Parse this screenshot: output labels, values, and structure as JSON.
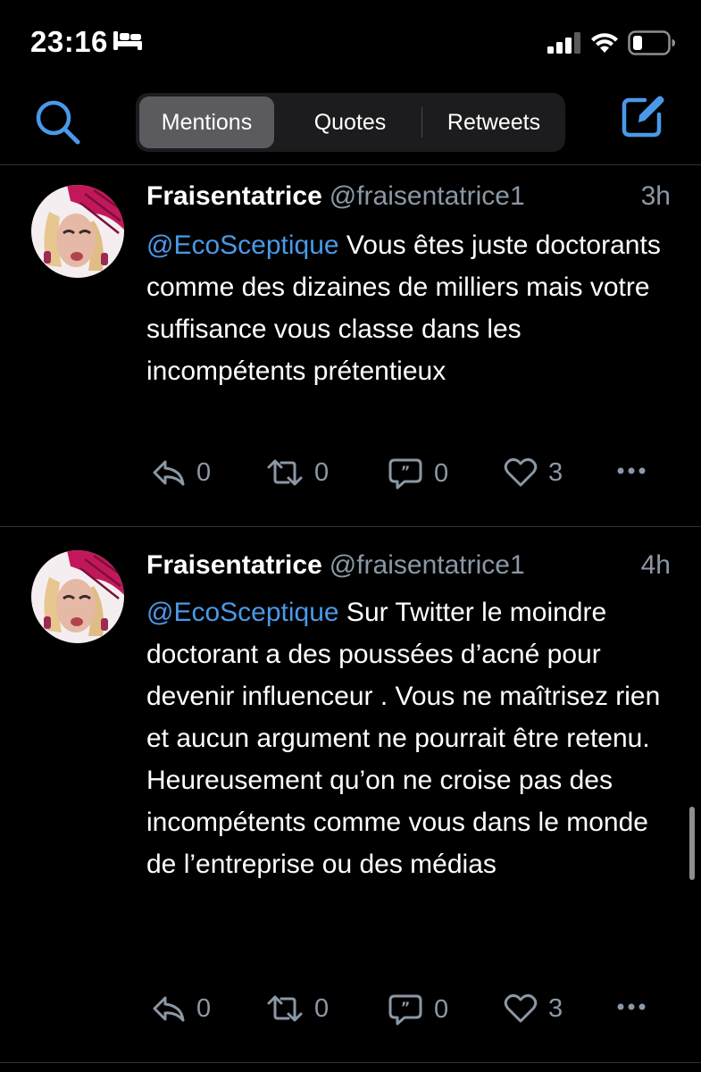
{
  "status_bar": {
    "time": "23:16",
    "icons": [
      "bed-icon",
      "signal-icon",
      "wifi-icon",
      "battery-icon"
    ]
  },
  "nav": {
    "tabs": [
      {
        "label": "Mentions",
        "active": true
      },
      {
        "label": "Quotes",
        "active": false
      },
      {
        "label": "Retweets",
        "active": false
      }
    ],
    "icons": [
      "search-icon",
      "compose-icon"
    ],
    "accent_color": "#4a99e9"
  },
  "tweets": [
    {
      "display_name": "Fraisentatrice",
      "handle": "@fraisentatrice1",
      "time": "3h",
      "mention": "@EcoSceptique",
      "body": " Vous êtes juste doctorants comme des dizaines de milliers mais votre suffisance vous classe dans les incompétents prétentieux",
      "replies": "0",
      "retweets": "0",
      "quotes": "0",
      "likes": "3"
    },
    {
      "display_name": "Fraisentatrice",
      "handle": "@fraisentatrice1",
      "time": "4h",
      "mention": "@EcoSceptique",
      "body": " Sur Twitter le moindre doctorant a des poussées d’acné pour devenir influenceur . Vous ne maîtrisez rien et aucun argument ne pourrait être retenu. Heureusement qu’on ne croise pas des incompétents comme vous dans le monde de l’entreprise ou des médias",
      "replies": "0",
      "retweets": "0",
      "quotes": "0",
      "likes": "3"
    }
  ],
  "colors": {
    "background": "#000000",
    "text": "#ffffff",
    "secondary": "#8b98a5",
    "link": "#4a99e9",
    "separator": "#2f3336"
  }
}
